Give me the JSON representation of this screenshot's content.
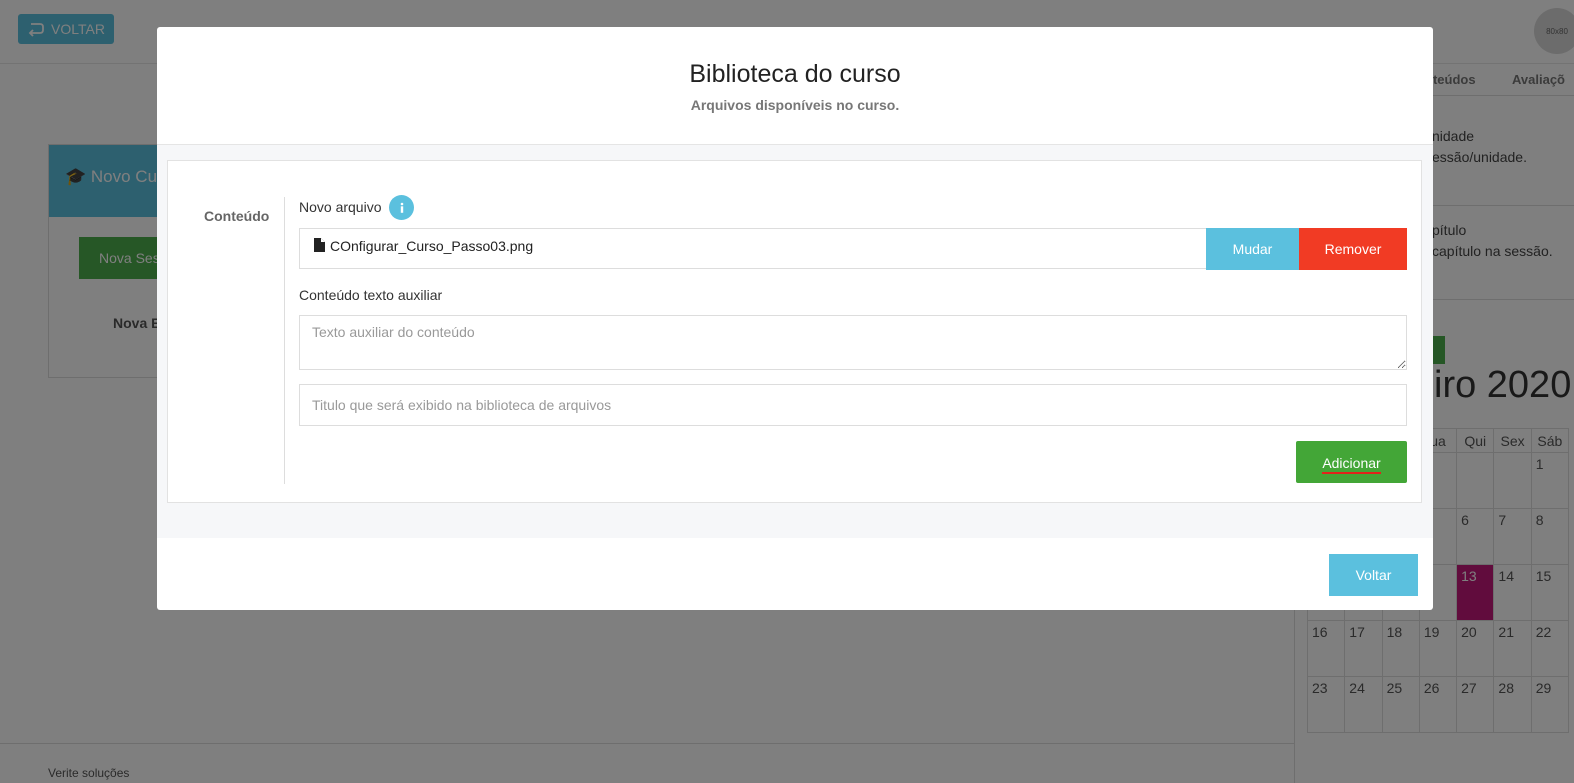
{
  "background": {
    "top_button_label": "VOLTAR",
    "avatar_text": "80x80",
    "tabs": [
      "nteúdos",
      "Avaliaçõ"
    ],
    "right_blocks": [
      {
        "line1": "nidade",
        "line2": "essão/unidade."
      },
      {
        "line1": "pítulo",
        "line2": "capítulo na sessão."
      }
    ],
    "calendar": {
      "title": "iro 2020",
      "headers": [
        "",
        "",
        "ua",
        "Qui",
        "Sex",
        "Sáb"
      ],
      "weeks": [
        [
          "",
          "",
          "",
          "",
          "",
          "1"
        ],
        [
          "",
          "",
          "",
          "6",
          "7",
          "8"
        ],
        [
          "",
          "",
          "",
          "13",
          "14",
          "15"
        ],
        [
          "16",
          "17",
          "18",
          "19",
          "20",
          "21",
          "22"
        ],
        [
          "23",
          "24",
          "25",
          "26",
          "27",
          "28",
          "29"
        ]
      ],
      "today": "13",
      "today_color": "#c2187b"
    },
    "left_card": {
      "header": "Novo Curs",
      "button": "Nova Ses",
      "link": "Nova E"
    },
    "footer": "Verite soluções"
  },
  "modal": {
    "title": "Biblioteca do curso",
    "subtitle": "Arquivos disponíveis no curso.",
    "section_label": "Conteúdo",
    "new_file_label": "Novo arquivo",
    "file_name": "COnfigurar_Curso_Passo03.png",
    "change_button": "Mudar",
    "remove_button": "Remover",
    "aux_label": "Conteúdo texto auxiliar",
    "aux_placeholder": "Texto auxiliar do conteúdo",
    "title_placeholder": "Titulo que será exibido na biblioteca de arquivos",
    "add_button": "Adicionar",
    "back_button": "Voltar"
  },
  "colors": {
    "info": "#5bc0de",
    "danger": "#f13b24",
    "success": "#43a637"
  }
}
